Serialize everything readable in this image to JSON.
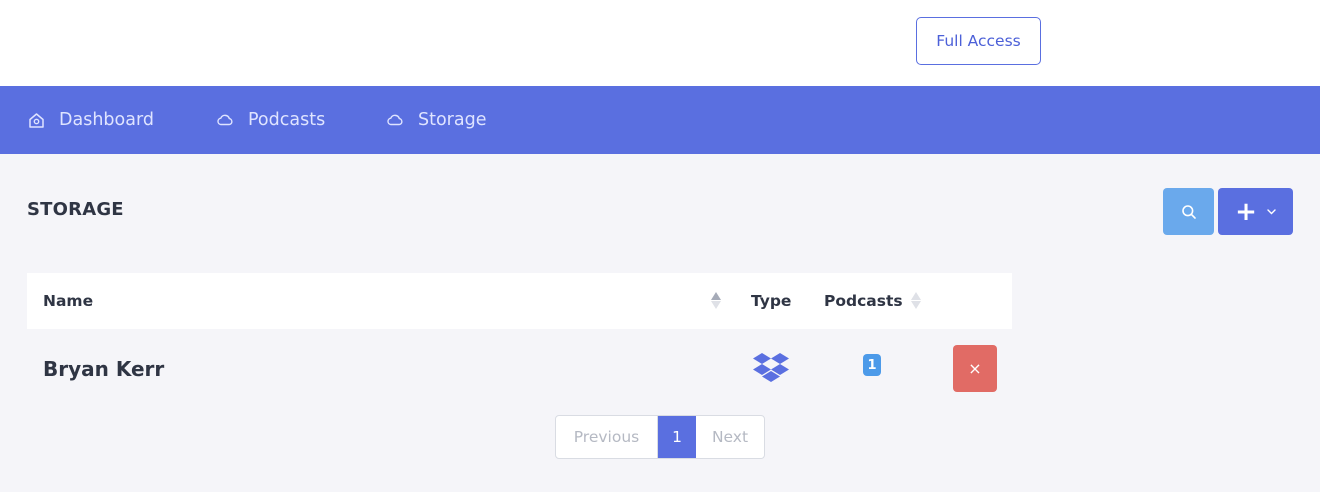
{
  "header": {
    "access_label": "Full Access"
  },
  "nav": {
    "items": [
      {
        "label": "Dashboard",
        "icon": "home-icon"
      },
      {
        "label": "Podcasts",
        "icon": "cloud-icon"
      },
      {
        "label": "Storage",
        "icon": "cloud-icon"
      }
    ]
  },
  "page": {
    "title": "STORAGE"
  },
  "toolbar": {
    "search_icon": "search-icon",
    "add_label": "+",
    "add_icon": "chevron-down-icon"
  },
  "table": {
    "columns": [
      "Name",
      "Type",
      "Podcasts"
    ],
    "rows": [
      {
        "name": "Bryan Kerr",
        "type_icon": "dropbox-icon",
        "podcasts": "1",
        "delete_label": "×"
      }
    ]
  },
  "pagination": {
    "previous": "Previous",
    "current": "1",
    "next": "Next"
  },
  "colors": {
    "accent": "#5a6fe0",
    "search": "#6aa9ec",
    "danger": "#e16b65",
    "badge": "#4c9ae9"
  }
}
